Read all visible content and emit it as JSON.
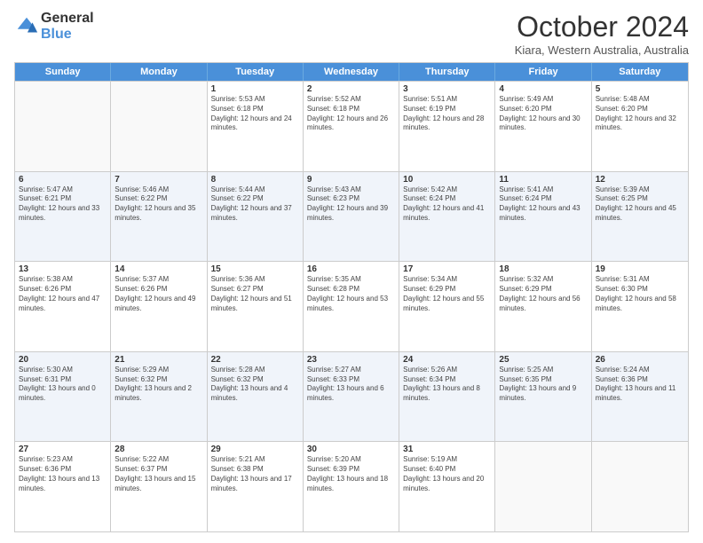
{
  "logo": {
    "general": "General",
    "blue": "Blue"
  },
  "header": {
    "title": "October 2024",
    "subtitle": "Kiara, Western Australia, Australia"
  },
  "days_of_week": [
    "Sunday",
    "Monday",
    "Tuesday",
    "Wednesday",
    "Thursday",
    "Friday",
    "Saturday"
  ],
  "weeks": [
    [
      {
        "day": "",
        "info": ""
      },
      {
        "day": "",
        "info": ""
      },
      {
        "day": "1",
        "info": "Sunrise: 5:53 AM\nSunset: 6:18 PM\nDaylight: 12 hours and 24 minutes."
      },
      {
        "day": "2",
        "info": "Sunrise: 5:52 AM\nSunset: 6:18 PM\nDaylight: 12 hours and 26 minutes."
      },
      {
        "day": "3",
        "info": "Sunrise: 5:51 AM\nSunset: 6:19 PM\nDaylight: 12 hours and 28 minutes."
      },
      {
        "day": "4",
        "info": "Sunrise: 5:49 AM\nSunset: 6:20 PM\nDaylight: 12 hours and 30 minutes."
      },
      {
        "day": "5",
        "info": "Sunrise: 5:48 AM\nSunset: 6:20 PM\nDaylight: 12 hours and 32 minutes."
      }
    ],
    [
      {
        "day": "6",
        "info": "Sunrise: 5:47 AM\nSunset: 6:21 PM\nDaylight: 12 hours and 33 minutes."
      },
      {
        "day": "7",
        "info": "Sunrise: 5:46 AM\nSunset: 6:22 PM\nDaylight: 12 hours and 35 minutes."
      },
      {
        "day": "8",
        "info": "Sunrise: 5:44 AM\nSunset: 6:22 PM\nDaylight: 12 hours and 37 minutes."
      },
      {
        "day": "9",
        "info": "Sunrise: 5:43 AM\nSunset: 6:23 PM\nDaylight: 12 hours and 39 minutes."
      },
      {
        "day": "10",
        "info": "Sunrise: 5:42 AM\nSunset: 6:24 PM\nDaylight: 12 hours and 41 minutes."
      },
      {
        "day": "11",
        "info": "Sunrise: 5:41 AM\nSunset: 6:24 PM\nDaylight: 12 hours and 43 minutes."
      },
      {
        "day": "12",
        "info": "Sunrise: 5:39 AM\nSunset: 6:25 PM\nDaylight: 12 hours and 45 minutes."
      }
    ],
    [
      {
        "day": "13",
        "info": "Sunrise: 5:38 AM\nSunset: 6:26 PM\nDaylight: 12 hours and 47 minutes."
      },
      {
        "day": "14",
        "info": "Sunrise: 5:37 AM\nSunset: 6:26 PM\nDaylight: 12 hours and 49 minutes."
      },
      {
        "day": "15",
        "info": "Sunrise: 5:36 AM\nSunset: 6:27 PM\nDaylight: 12 hours and 51 minutes."
      },
      {
        "day": "16",
        "info": "Sunrise: 5:35 AM\nSunset: 6:28 PM\nDaylight: 12 hours and 53 minutes."
      },
      {
        "day": "17",
        "info": "Sunrise: 5:34 AM\nSunset: 6:29 PM\nDaylight: 12 hours and 55 minutes."
      },
      {
        "day": "18",
        "info": "Sunrise: 5:32 AM\nSunset: 6:29 PM\nDaylight: 12 hours and 56 minutes."
      },
      {
        "day": "19",
        "info": "Sunrise: 5:31 AM\nSunset: 6:30 PM\nDaylight: 12 hours and 58 minutes."
      }
    ],
    [
      {
        "day": "20",
        "info": "Sunrise: 5:30 AM\nSunset: 6:31 PM\nDaylight: 13 hours and 0 minutes."
      },
      {
        "day": "21",
        "info": "Sunrise: 5:29 AM\nSunset: 6:32 PM\nDaylight: 13 hours and 2 minutes."
      },
      {
        "day": "22",
        "info": "Sunrise: 5:28 AM\nSunset: 6:32 PM\nDaylight: 13 hours and 4 minutes."
      },
      {
        "day": "23",
        "info": "Sunrise: 5:27 AM\nSunset: 6:33 PM\nDaylight: 13 hours and 6 minutes."
      },
      {
        "day": "24",
        "info": "Sunrise: 5:26 AM\nSunset: 6:34 PM\nDaylight: 13 hours and 8 minutes."
      },
      {
        "day": "25",
        "info": "Sunrise: 5:25 AM\nSunset: 6:35 PM\nDaylight: 13 hours and 9 minutes."
      },
      {
        "day": "26",
        "info": "Sunrise: 5:24 AM\nSunset: 6:36 PM\nDaylight: 13 hours and 11 minutes."
      }
    ],
    [
      {
        "day": "27",
        "info": "Sunrise: 5:23 AM\nSunset: 6:36 PM\nDaylight: 13 hours and 13 minutes."
      },
      {
        "day": "28",
        "info": "Sunrise: 5:22 AM\nSunset: 6:37 PM\nDaylight: 13 hours and 15 minutes."
      },
      {
        "day": "29",
        "info": "Sunrise: 5:21 AM\nSunset: 6:38 PM\nDaylight: 13 hours and 17 minutes."
      },
      {
        "day": "30",
        "info": "Sunrise: 5:20 AM\nSunset: 6:39 PM\nDaylight: 13 hours and 18 minutes."
      },
      {
        "day": "31",
        "info": "Sunrise: 5:19 AM\nSunset: 6:40 PM\nDaylight: 13 hours and 20 minutes."
      },
      {
        "day": "",
        "info": ""
      },
      {
        "day": "",
        "info": ""
      }
    ]
  ]
}
